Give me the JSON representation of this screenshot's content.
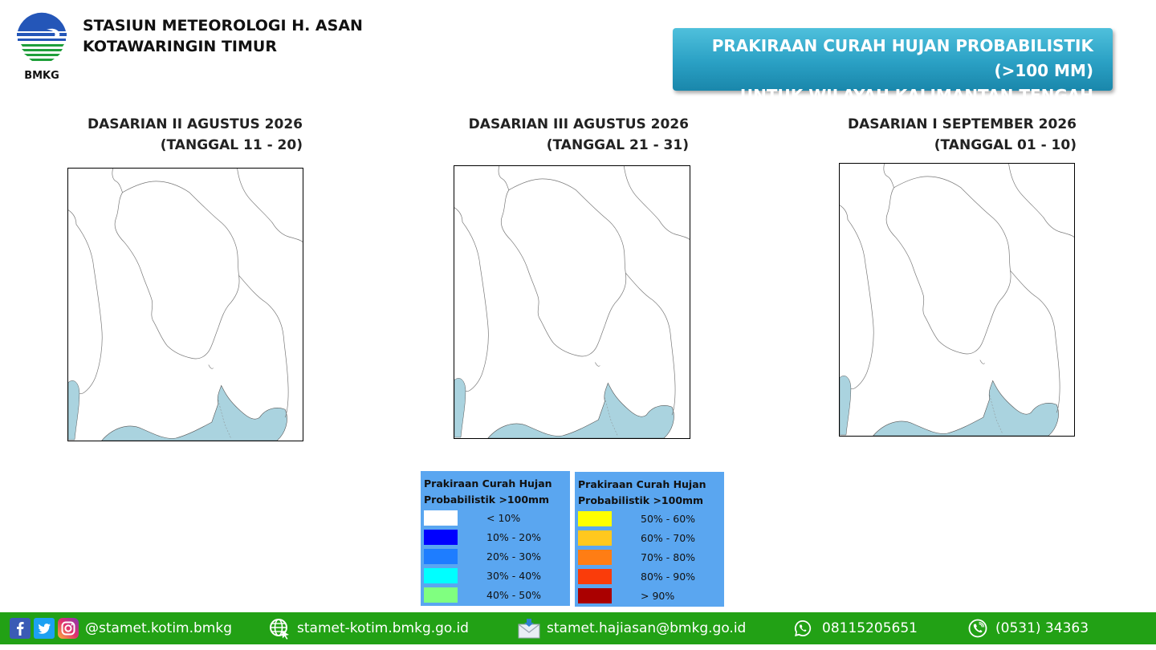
{
  "header": {
    "logo_text": "BMKG",
    "station_line1": "STASIUN METEOROLOGI H. ASAN",
    "station_line2": "KOTAWARINGIN TIMUR",
    "title_line1": "PRAKIRAAN CURAH HUJAN PROBABILISTIK (>100 MM)",
    "title_line2": "UNTUK WILAYAH KALIMANTAN TENGAH"
  },
  "periods": [
    {
      "line1": "DASARIAN II AGUSTUS 2026",
      "line2": "(TANGGAL 11 - 20)"
    },
    {
      "line1": "DASARIAN III AGUSTUS 2026",
      "line2": "(TANGGAL 21 - 31)"
    },
    {
      "line1": "DASARIAN I SEPTEMBER 2026",
      "line2": "(TANGGAL 01 - 10)"
    }
  ],
  "legend": {
    "title_line1": "Prakiraan Curah Hujan",
    "title_line2": "Probabilistik >100mm",
    "left": [
      {
        "label": "< 10%",
        "color": "#ffffff"
      },
      {
        "label": "10% - 20%",
        "color": "#0000ff"
      },
      {
        "label": "20% - 30%",
        "color": "#1e7dff"
      },
      {
        "label": "30% - 40%",
        "color": "#00ffff"
      },
      {
        "label": "40% - 50%",
        "color": "#80ff80"
      }
    ],
    "right": [
      {
        "label": "50% - 60%",
        "color": "#ffff00"
      },
      {
        "label": "60% - 70%",
        "color": "#ffc81e"
      },
      {
        "label": "70% - 80%",
        "color": "#ff7d14"
      },
      {
        "label": "80% - 90%",
        "color": "#fa3c0a"
      },
      {
        "label": "> 90%",
        "color": "#aa0000"
      }
    ]
  },
  "colors": {
    "sea": "#aad3df",
    "footer": "#22a115",
    "banner": "#2aa0c4"
  },
  "footer": {
    "instagram": "@stamet.kotim.bmkg",
    "website": "stamet-kotim.bmkg.go.id",
    "email": "stamet.hajiasan@bmkg.go.id",
    "whatsapp": "08115205651",
    "phone": "(0531) 34363"
  }
}
